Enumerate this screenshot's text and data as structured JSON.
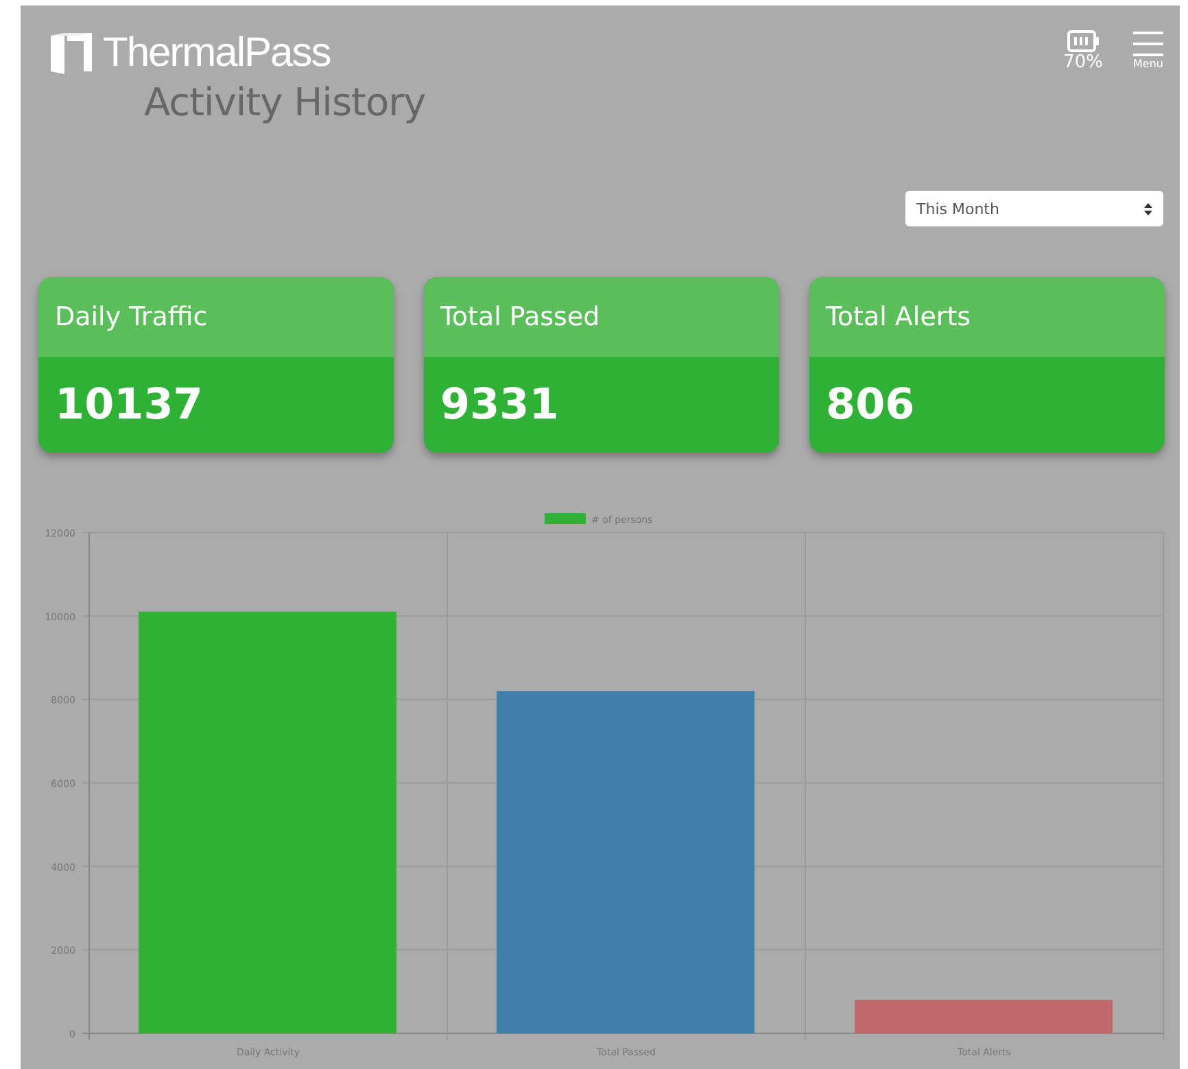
{
  "header": {
    "brand": "ThermalPass",
    "title": "Activity History",
    "battery": "70%",
    "menu_label": "Menu"
  },
  "period_select": {
    "value": "This Month"
  },
  "cards": [
    {
      "label": "Daily Traffic",
      "value": "10137"
    },
    {
      "label": "Total Passed",
      "value": "9331"
    },
    {
      "label": "Total Alerts",
      "value": "806"
    }
  ],
  "chart": {
    "chart_data": {
      "type": "bar",
      "categories": [
        "Daily Activity",
        "Total Passed",
        "Total Alerts"
      ],
      "series": [
        {
          "name": "# of persons",
          "color": "#2eb135",
          "colors": [
            "#2eb135",
            "#4080a8",
            "#c0686a"
          ],
          "values": [
            10100,
            8200,
            800
          ]
        }
      ],
      "grid": true,
      "ylim": [
        0,
        12000
      ],
      "yticks": [
        0,
        2000,
        4000,
        6000,
        8000,
        10000,
        12000
      ]
    }
  }
}
